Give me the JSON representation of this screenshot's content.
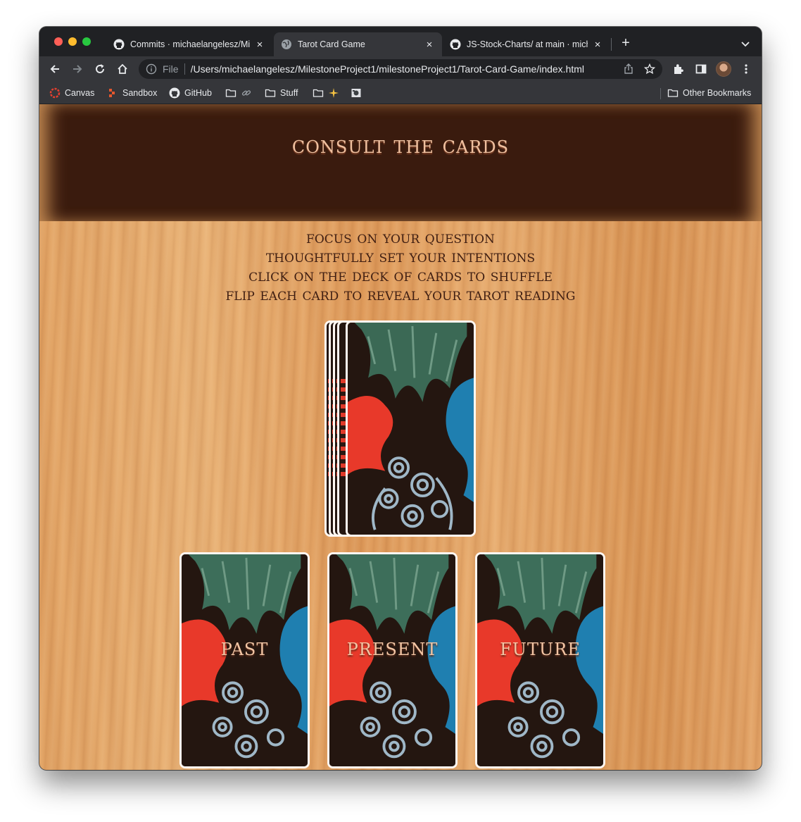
{
  "browser": {
    "tabs": [
      {
        "title": "Commits · michaelangelesz/Milestone",
        "icon": "github-icon",
        "active": false
      },
      {
        "title": "Tarot Card Game",
        "icon": "globe-icon",
        "active": true
      },
      {
        "title": "JS-Stock-Charts/ at main · michaelangelesz",
        "icon": "github-icon",
        "active": false
      }
    ],
    "address": {
      "scheme_label": "File",
      "url": "/Users/michaelangelesz/MilestoneProject1/milestoneProject1/Tarot-Card-Game/index.html"
    },
    "bookmarks": [
      {
        "label": "Canvas",
        "icon": "canvas-icon"
      },
      {
        "label": "Sandbox",
        "icon": "sandbox-icon"
      },
      {
        "label": "GitHub",
        "icon": "github-icon"
      },
      {
        "label": "",
        "icon": "folder-link-icon"
      },
      {
        "label": "Stuff",
        "icon": "folder-icon"
      },
      {
        "label": "",
        "icon": "folder-sparkle-icon"
      },
      {
        "label": "",
        "icon": "image-icon"
      }
    ],
    "other_bookmarks": "Other Bookmarks"
  },
  "page": {
    "title": "consult the cards",
    "instructions": [
      "focus on your question",
      "thoughtfully set your intentions",
      "click on the deck of cards to shuffle",
      "flip each card to reveal your tarot reading"
    ],
    "spread": [
      {
        "label": "past"
      },
      {
        "label": "present"
      },
      {
        "label": "future"
      }
    ]
  },
  "colors": {
    "banner": "#3a1b0e",
    "title_text": "#efc09f",
    "instruction_text": "#3f1e12",
    "card_border": "#fff8f2",
    "card_red": "#e8392a",
    "card_blue": "#1f7fb0",
    "card_green": "#3d6e5a"
  }
}
